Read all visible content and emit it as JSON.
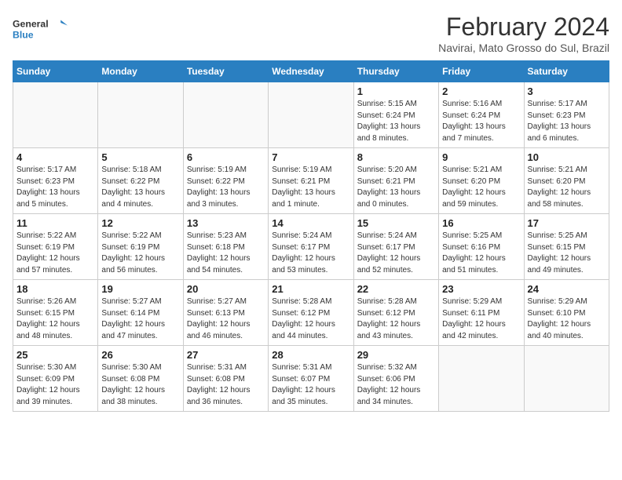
{
  "header": {
    "logo_general": "General",
    "logo_blue": "Blue",
    "month_title": "February 2024",
    "location": "Navirai, Mato Grosso do Sul, Brazil"
  },
  "weekdays": [
    "Sunday",
    "Monday",
    "Tuesday",
    "Wednesday",
    "Thursday",
    "Friday",
    "Saturday"
  ],
  "weeks": [
    [
      {
        "day": "",
        "info": ""
      },
      {
        "day": "",
        "info": ""
      },
      {
        "day": "",
        "info": ""
      },
      {
        "day": "",
        "info": ""
      },
      {
        "day": "1",
        "info": "Sunrise: 5:15 AM\nSunset: 6:24 PM\nDaylight: 13 hours\nand 8 minutes."
      },
      {
        "day": "2",
        "info": "Sunrise: 5:16 AM\nSunset: 6:24 PM\nDaylight: 13 hours\nand 7 minutes."
      },
      {
        "day": "3",
        "info": "Sunrise: 5:17 AM\nSunset: 6:23 PM\nDaylight: 13 hours\nand 6 minutes."
      }
    ],
    [
      {
        "day": "4",
        "info": "Sunrise: 5:17 AM\nSunset: 6:23 PM\nDaylight: 13 hours\nand 5 minutes."
      },
      {
        "day": "5",
        "info": "Sunrise: 5:18 AM\nSunset: 6:22 PM\nDaylight: 13 hours\nand 4 minutes."
      },
      {
        "day": "6",
        "info": "Sunrise: 5:19 AM\nSunset: 6:22 PM\nDaylight: 13 hours\nand 3 minutes."
      },
      {
        "day": "7",
        "info": "Sunrise: 5:19 AM\nSunset: 6:21 PM\nDaylight: 13 hours\nand 1 minute."
      },
      {
        "day": "8",
        "info": "Sunrise: 5:20 AM\nSunset: 6:21 PM\nDaylight: 13 hours\nand 0 minutes."
      },
      {
        "day": "9",
        "info": "Sunrise: 5:21 AM\nSunset: 6:20 PM\nDaylight: 12 hours\nand 59 minutes."
      },
      {
        "day": "10",
        "info": "Sunrise: 5:21 AM\nSunset: 6:20 PM\nDaylight: 12 hours\nand 58 minutes."
      }
    ],
    [
      {
        "day": "11",
        "info": "Sunrise: 5:22 AM\nSunset: 6:19 PM\nDaylight: 12 hours\nand 57 minutes."
      },
      {
        "day": "12",
        "info": "Sunrise: 5:22 AM\nSunset: 6:19 PM\nDaylight: 12 hours\nand 56 minutes."
      },
      {
        "day": "13",
        "info": "Sunrise: 5:23 AM\nSunset: 6:18 PM\nDaylight: 12 hours\nand 54 minutes."
      },
      {
        "day": "14",
        "info": "Sunrise: 5:24 AM\nSunset: 6:17 PM\nDaylight: 12 hours\nand 53 minutes."
      },
      {
        "day": "15",
        "info": "Sunrise: 5:24 AM\nSunset: 6:17 PM\nDaylight: 12 hours\nand 52 minutes."
      },
      {
        "day": "16",
        "info": "Sunrise: 5:25 AM\nSunset: 6:16 PM\nDaylight: 12 hours\nand 51 minutes."
      },
      {
        "day": "17",
        "info": "Sunrise: 5:25 AM\nSunset: 6:15 PM\nDaylight: 12 hours\nand 49 minutes."
      }
    ],
    [
      {
        "day": "18",
        "info": "Sunrise: 5:26 AM\nSunset: 6:15 PM\nDaylight: 12 hours\nand 48 minutes."
      },
      {
        "day": "19",
        "info": "Sunrise: 5:27 AM\nSunset: 6:14 PM\nDaylight: 12 hours\nand 47 minutes."
      },
      {
        "day": "20",
        "info": "Sunrise: 5:27 AM\nSunset: 6:13 PM\nDaylight: 12 hours\nand 46 minutes."
      },
      {
        "day": "21",
        "info": "Sunrise: 5:28 AM\nSunset: 6:12 PM\nDaylight: 12 hours\nand 44 minutes."
      },
      {
        "day": "22",
        "info": "Sunrise: 5:28 AM\nSunset: 6:12 PM\nDaylight: 12 hours\nand 43 minutes."
      },
      {
        "day": "23",
        "info": "Sunrise: 5:29 AM\nSunset: 6:11 PM\nDaylight: 12 hours\nand 42 minutes."
      },
      {
        "day": "24",
        "info": "Sunrise: 5:29 AM\nSunset: 6:10 PM\nDaylight: 12 hours\nand 40 minutes."
      }
    ],
    [
      {
        "day": "25",
        "info": "Sunrise: 5:30 AM\nSunset: 6:09 PM\nDaylight: 12 hours\nand 39 minutes."
      },
      {
        "day": "26",
        "info": "Sunrise: 5:30 AM\nSunset: 6:08 PM\nDaylight: 12 hours\nand 38 minutes."
      },
      {
        "day": "27",
        "info": "Sunrise: 5:31 AM\nSunset: 6:08 PM\nDaylight: 12 hours\nand 36 minutes."
      },
      {
        "day": "28",
        "info": "Sunrise: 5:31 AM\nSunset: 6:07 PM\nDaylight: 12 hours\nand 35 minutes."
      },
      {
        "day": "29",
        "info": "Sunrise: 5:32 AM\nSunset: 6:06 PM\nDaylight: 12 hours\nand 34 minutes."
      },
      {
        "day": "",
        "info": ""
      },
      {
        "day": "",
        "info": ""
      }
    ]
  ]
}
